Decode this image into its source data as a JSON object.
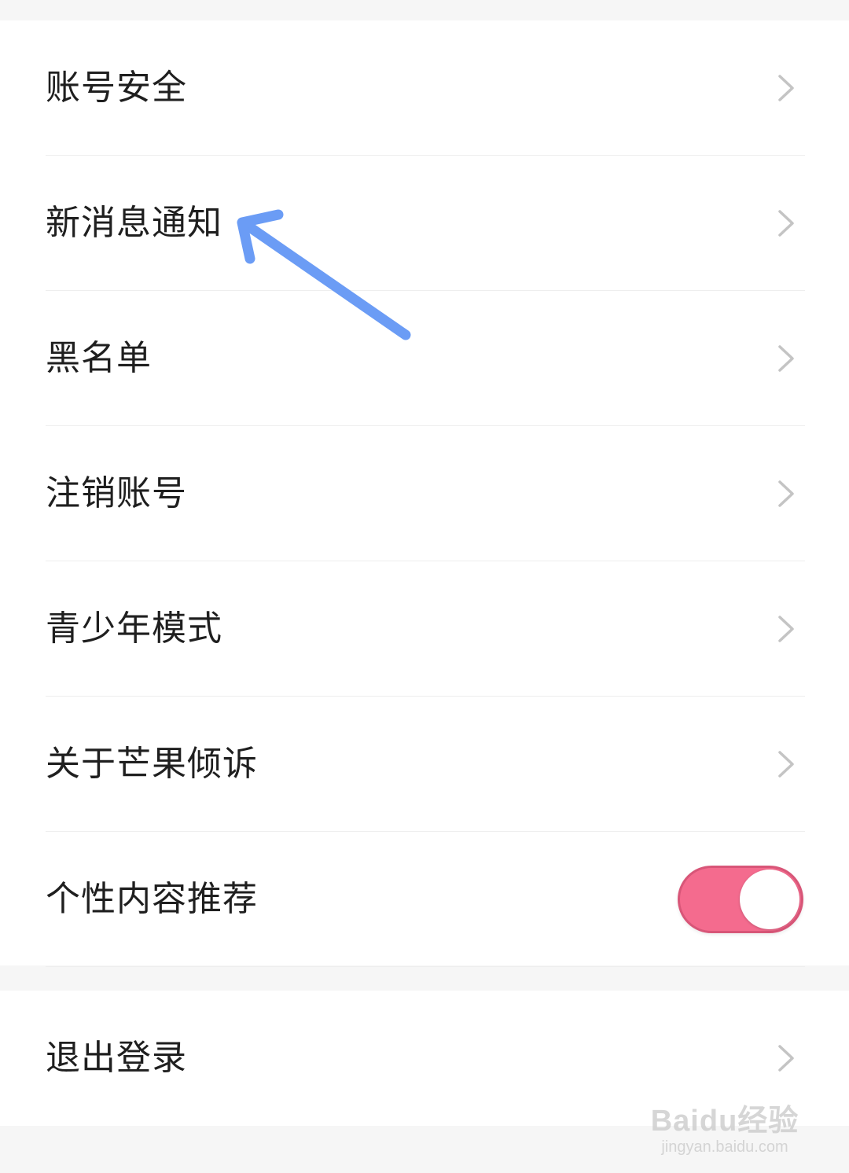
{
  "settings": {
    "items": [
      {
        "label": "账号安全"
      },
      {
        "label": "新消息通知"
      },
      {
        "label": "黑名单"
      },
      {
        "label": "注销账号"
      },
      {
        "label": "青少年模式"
      },
      {
        "label": "关于芒果倾诉"
      }
    ],
    "personalized": {
      "label": "个性内容推荐",
      "enabled": true,
      "toggle_color": "#f46b8e"
    },
    "logout": {
      "label": "退出登录"
    }
  },
  "annotation": {
    "arrow_color": "#6b9cf5"
  },
  "watermark": {
    "logo": "Baidu经验",
    "url": "jingyan.baidu.com"
  },
  "icons": {
    "chevron": "chevron-right-icon"
  }
}
